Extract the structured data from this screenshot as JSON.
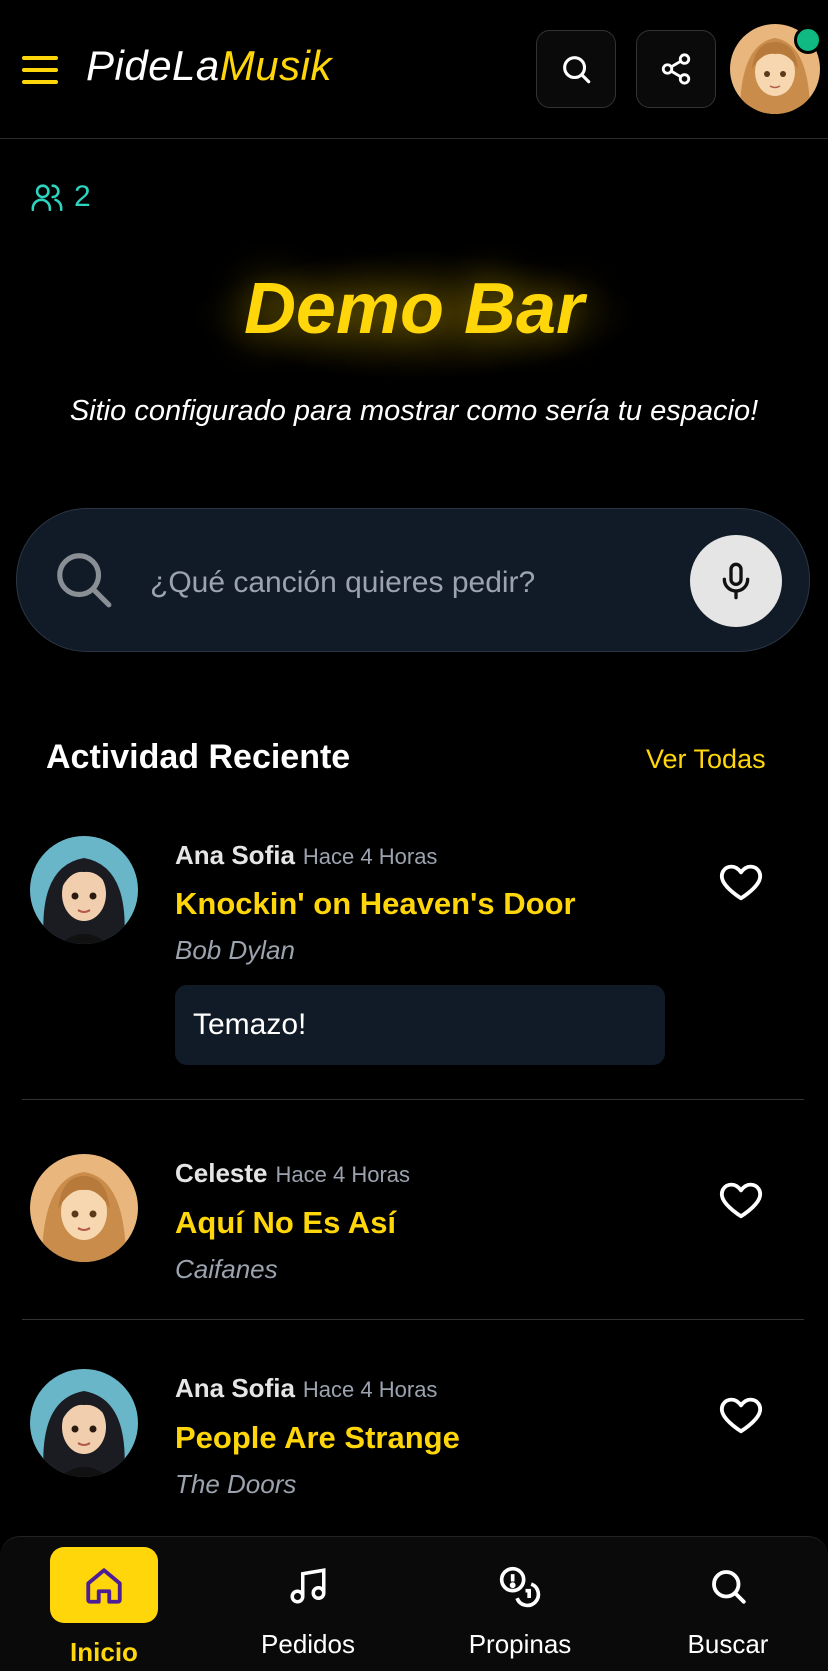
{
  "header": {
    "logo_part1": "PideLa",
    "logo_part2": "Musik"
  },
  "venue": {
    "users_count": "2",
    "title": "Demo Bar",
    "subtitle": "Sitio configurado para mostrar como sería tu espacio!"
  },
  "search": {
    "placeholder": "¿Qué canción quieres pedir?"
  },
  "activity": {
    "title": "Actividad Reciente",
    "see_all": "Ver Todas",
    "items": [
      {
        "user": "Ana Sofia",
        "time": "Hace 4 Horas",
        "song": "Knockin' on Heaven's Door",
        "artist": "Bob Dylan",
        "comment": "Temazo!"
      },
      {
        "user": "Celeste",
        "time": "Hace 4 Horas",
        "song": "Aquí No Es Así",
        "artist": "Caifanes"
      },
      {
        "user": "Ana Sofia",
        "time": "Hace 4 Horas",
        "song": "People Are Strange",
        "artist": "The Doors"
      }
    ]
  },
  "nav": {
    "items": [
      {
        "label": "Inicio",
        "icon": "home-icon",
        "active": true
      },
      {
        "label": "Pedidos",
        "icon": "music-note-icon"
      },
      {
        "label": "Propinas",
        "icon": "coins-icon"
      },
      {
        "label": "Buscar",
        "icon": "search-icon"
      }
    ]
  },
  "colors": {
    "accent": "#ffd60a",
    "background": "#000000",
    "surface": "#111b27",
    "online": "#10b981",
    "users": "#2dd4bf"
  }
}
